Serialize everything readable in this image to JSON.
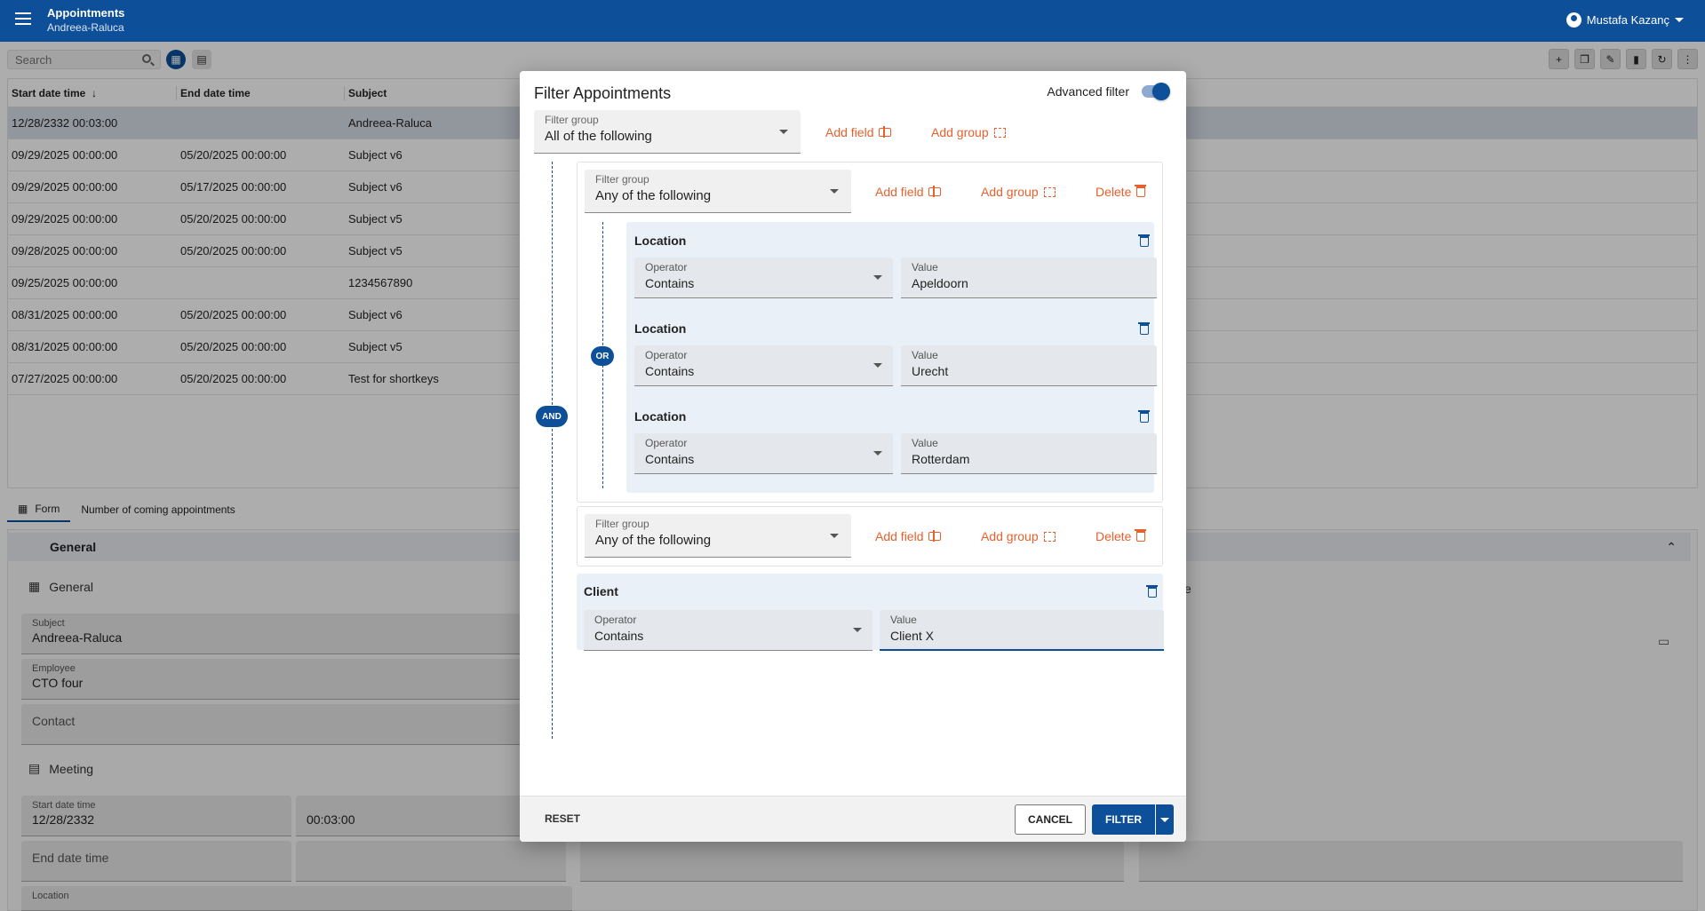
{
  "header": {
    "title": "Appointments",
    "subtitle": "Andreea-Raluca",
    "user": "Mustafa Kazanç"
  },
  "search": {
    "placeholder": "Search"
  },
  "table": {
    "columns": [
      "Start date time",
      "End date time",
      "Subject"
    ],
    "rows": [
      [
        "12/28/2332 00:03:00",
        "",
        "Andreea-Raluca"
      ],
      [
        "09/29/2025 00:00:00",
        "05/20/2025 00:00:00",
        "Subject v6"
      ],
      [
        "09/29/2025 00:00:00",
        "05/17/2025 00:00:00",
        "Subject v6"
      ],
      [
        "09/29/2025 00:00:00",
        "05/20/2025 00:00:00",
        "Subject v5"
      ],
      [
        "09/28/2025 00:00:00",
        "05/20/2025 00:00:00",
        "Subject v5"
      ],
      [
        "09/25/2025 00:00:00",
        "",
        "1234567890"
      ],
      [
        "08/31/2025 00:00:00",
        "05/20/2025 00:00:00",
        "Subject v6"
      ],
      [
        "08/31/2025 00:00:00",
        "05/20/2025 00:00:00",
        "Subject v5"
      ],
      [
        "07/27/2025 00:00:00",
        "05/20/2025 00:00:00",
        "Test for shortkeys"
      ]
    ]
  },
  "tabs": {
    "form": "Form",
    "coming": "Number of coming appointments"
  },
  "form": {
    "section": "General",
    "general_sub": "General",
    "subject_label": "Subject",
    "subject_value": "Andreea-Raluca",
    "employee_label": "Employee",
    "employee_value": "CTO four",
    "contact_placeholder": "Contact",
    "meeting_sub": "Meeting",
    "start_label": "Start date time",
    "start_date": "12/28/2332",
    "start_time": "00:03:00",
    "end_placeholder": "End date time",
    "location_label": "Location",
    "right_partial": "e"
  },
  "dialog": {
    "title": "Filter Appointments",
    "advanced_label": "Advanced filter",
    "filter_group_label": "Filter group",
    "root_group_value": "All of the following",
    "add_field": "Add field",
    "add_group": "Add group",
    "delete": "Delete",
    "and_chip": "AND",
    "or_chip": "OR",
    "group1_value": "Any of the following",
    "operator_label": "Operator",
    "value_label": "Value",
    "conditions": [
      {
        "field": "Location",
        "operator": "Contains",
        "value": "Apeldoorn"
      },
      {
        "field": "Location",
        "operator": "Contains",
        "value": "Urecht"
      },
      {
        "field": "Location",
        "operator": "Contains",
        "value": "Rotterdam"
      }
    ],
    "group2_value": "Any of the following",
    "client": {
      "field": "Client",
      "operator": "Contains",
      "value": "Client X"
    },
    "reset": "RESET",
    "cancel": "CANCEL",
    "filter": "FILTER"
  },
  "colors": {
    "primary": "#0d4f98",
    "accent": "#e8602c"
  }
}
